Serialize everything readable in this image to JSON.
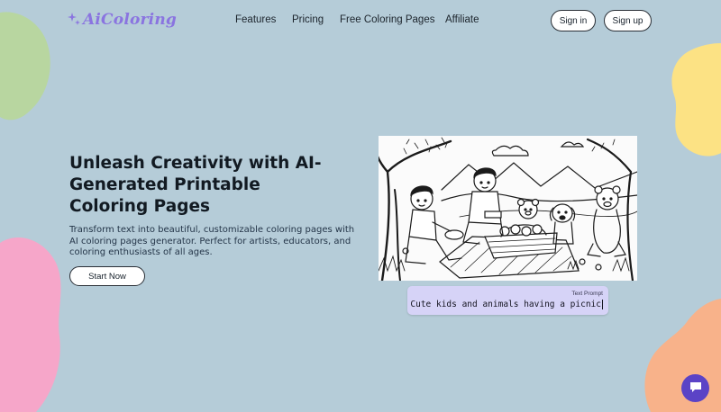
{
  "brand": {
    "name": "AiColoring",
    "accent": "#8a74e0"
  },
  "nav": {
    "items": [
      "Features",
      "Pricing",
      "Free Coloring Pages",
      "Affiliate"
    ],
    "sign_in": "Sign in",
    "sign_up": "Sign up"
  },
  "hero": {
    "title": "Unleash Creativity with AI-Generated Printable Coloring Pages",
    "subtitle": "Transform text into beautiful, customizable coloring pages with AI coloring pages generator. Perfect for artists, educators, and coloring enthusiasts of all ages.",
    "cta": "Start Now"
  },
  "prompt": {
    "label": "Text Prompt",
    "value": "Cute kids and animals having a picnic"
  },
  "icons": {
    "logo": "sparkle-icon",
    "chat": "chat-bubble-icon"
  },
  "colors": {
    "background": "#b5ccd8",
    "blob_green": "#b8d6a0",
    "blob_yellow": "#fce284",
    "blob_pink": "#f6a6c9",
    "blob_orange": "#f8b28a",
    "chat_button": "#5b43c6"
  }
}
